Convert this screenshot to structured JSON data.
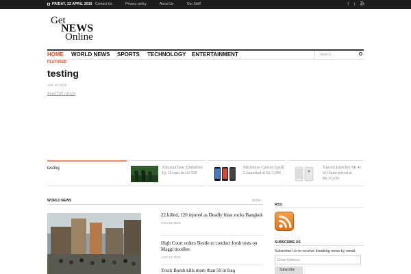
{
  "topbar": {
    "date": "FRIDAY, 22 APRIL 2016",
    "links": [
      "Contact Us",
      "Privacy policy",
      "About Us",
      "Our Staff"
    ],
    "social": [
      "f",
      "t",
      "rss"
    ]
  },
  "logo": {
    "line1": "Get",
    "line2": "NEWS",
    "line3": "Online"
  },
  "nav": {
    "items": [
      "HOME",
      "WORLD NEWS",
      "SPORTS",
      "TECHNOLOGY",
      "ENTERTAINMENT"
    ],
    "search_placeholder": "Search..."
  },
  "featured": {
    "label": "FEATURED",
    "title": "testing",
    "date": "APR 22, 2016",
    "read_more": "Read Full Article"
  },
  "ticker": {
    "first": "testing",
    "cards": [
      {
        "text": "Pakistan beat Zimbabwe by 15 runs in 1st T20"
      },
      {
        "text": "Micromax Canvas Spark 2 launched at Rs.3,999"
      },
      {
        "text": "Xiaomi launches Mi 4c in China priced at Rs.15,650"
      }
    ]
  },
  "world_news": {
    "label": "WORLD NEWS",
    "more": "MORE",
    "stories": [
      {
        "title": "22 killed, 120 injured as Deadly blast rocks Bangkok",
        "date": "AUG 18, 2015"
      },
      {
        "title": "High Court orders Nestle to conduct fresh tests on Maggi noodles",
        "date": "AUG 13, 2015"
      },
      {
        "title": "Truck Bomb kills more than 50 in Iraq",
        "date": ""
      }
    ]
  },
  "sidebar": {
    "rss_label": "RSS",
    "subscribe_label": "SUBSCRIBE US",
    "subscribe_text": "Subscribe Us to receive breaking news by email.",
    "email_placeholder": "Email Address",
    "subscribe_button": "Subscribe"
  }
}
